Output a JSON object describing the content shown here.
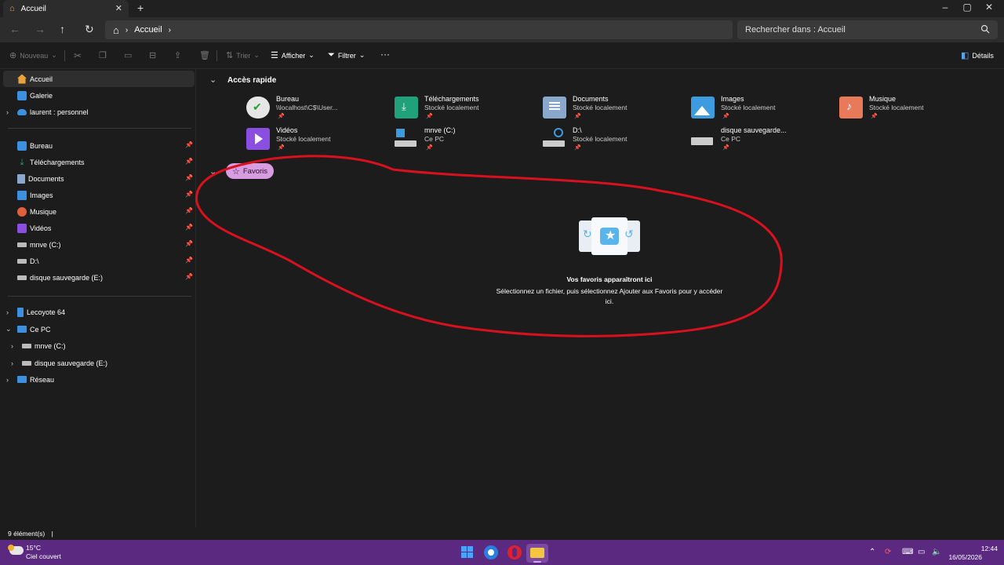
{
  "window": {
    "tab_title": "Accueil",
    "new_tab": "+",
    "minimize": "–",
    "maximize": "▢",
    "close": "✕"
  },
  "nav": {
    "address": "Accueil",
    "search_placeholder": "Rechercher dans : Accueil"
  },
  "toolbar": {
    "new_label": "Nouveau",
    "sort_label": "Trier",
    "view_label": "Afficher",
    "filter_label": "Filtrer",
    "more_label": "···",
    "details_label": "Détails"
  },
  "sidebar": {
    "top": [
      {
        "label": "Accueil",
        "icon": "home-icon",
        "color": "#e8a23c"
      },
      {
        "label": "Galerie",
        "icon": "gallery-icon",
        "color": "#3d8fe0"
      },
      {
        "label": "laurent : personnel",
        "icon": "cloud-icon",
        "color": "#3d8fe0"
      }
    ],
    "pinned": [
      {
        "label": "Bureau",
        "icon": "desktop-icon",
        "color": "#3d8fe0"
      },
      {
        "label": "Téléchargements",
        "icon": "download-icon",
        "color": "#25a56b"
      },
      {
        "label": "Documents",
        "icon": "documents-icon",
        "color": "#8aa8cc"
      },
      {
        "label": "Images",
        "icon": "images-icon",
        "color": "#3d8fe0"
      },
      {
        "label": "Musique",
        "icon": "music-icon",
        "color": "#e0603d"
      },
      {
        "label": "Vidéos",
        "icon": "videos-icon",
        "color": "#8a4fe0"
      },
      {
        "label": "mnve (C:)",
        "icon": "drive-icon",
        "color": "#bbbbbb"
      },
      {
        "label": "D:\\",
        "icon": "drive-icon",
        "color": "#bbbbbb"
      },
      {
        "label": "disque sauvegarde (E:)",
        "icon": "drive-icon",
        "color": "#bbbbbb"
      }
    ],
    "tree": [
      {
        "label": "Lecoyote 64",
        "icon": "usb-icon",
        "color": "#3d8fe0"
      },
      {
        "label": "Ce PC",
        "icon": "pc-icon",
        "color": "#3d8fe0"
      },
      {
        "label": "mnve (C:)",
        "icon": "drive-icon",
        "color": "#bbbbbb"
      },
      {
        "label": "disque sauvegarde (E:)",
        "icon": "drive-icon",
        "color": "#bbbbbb"
      },
      {
        "label": "Réseau",
        "icon": "network-icon",
        "color": "#3d8fe0"
      }
    ]
  },
  "main": {
    "quick_access_title": "Accès rapide",
    "quick_access": [
      {
        "name": "Bureau",
        "sub": "\\\\localhost\\C$\\User...",
        "icon": "desktop-sync-icon",
        "color": "#e6e6e6"
      },
      {
        "name": "Téléchargements",
        "sub": "Stocké localement",
        "icon": "download-folder-icon",
        "color": "#1fa27a"
      },
      {
        "name": "Documents",
        "sub": "Stocké localement",
        "icon": "documents-folder-icon",
        "color": "#8aa8cc"
      },
      {
        "name": "Images",
        "sub": "Stocké localement",
        "icon": "images-folder-icon",
        "color": "#3d9be0"
      },
      {
        "name": "Musique",
        "sub": "Stocké localement",
        "icon": "music-folder-icon",
        "color": "#e87a5a"
      },
      {
        "name": "Vidéos",
        "sub": "Stocké localement",
        "icon": "videos-folder-icon",
        "color": "#8a4fe0"
      },
      {
        "name": "mnve (C:)",
        "sub": "Ce PC",
        "icon": "windows-drive-icon",
        "color": "#cccccc"
      },
      {
        "name": "D:\\",
        "sub": "Stocké localement",
        "icon": "network-drive-icon",
        "color": "#cccccc"
      },
      {
        "name": "disque sauvegarde...",
        "sub": "Ce PC",
        "icon": "drive-icon",
        "color": "#cccccc"
      }
    ],
    "favorites_label": "Favoris",
    "empty_title": "Vos favoris apparaîtront ici",
    "empty_desc": "Sélectionnez un fichier, puis sélectionnez Ajouter aux Favoris pour y accéder ici."
  },
  "status": {
    "count": "9 élément(s)"
  },
  "taskbar": {
    "temp": "15°C",
    "weather": "Ciel couvert",
    "time": "12:44",
    "date": "16/05/2026"
  }
}
